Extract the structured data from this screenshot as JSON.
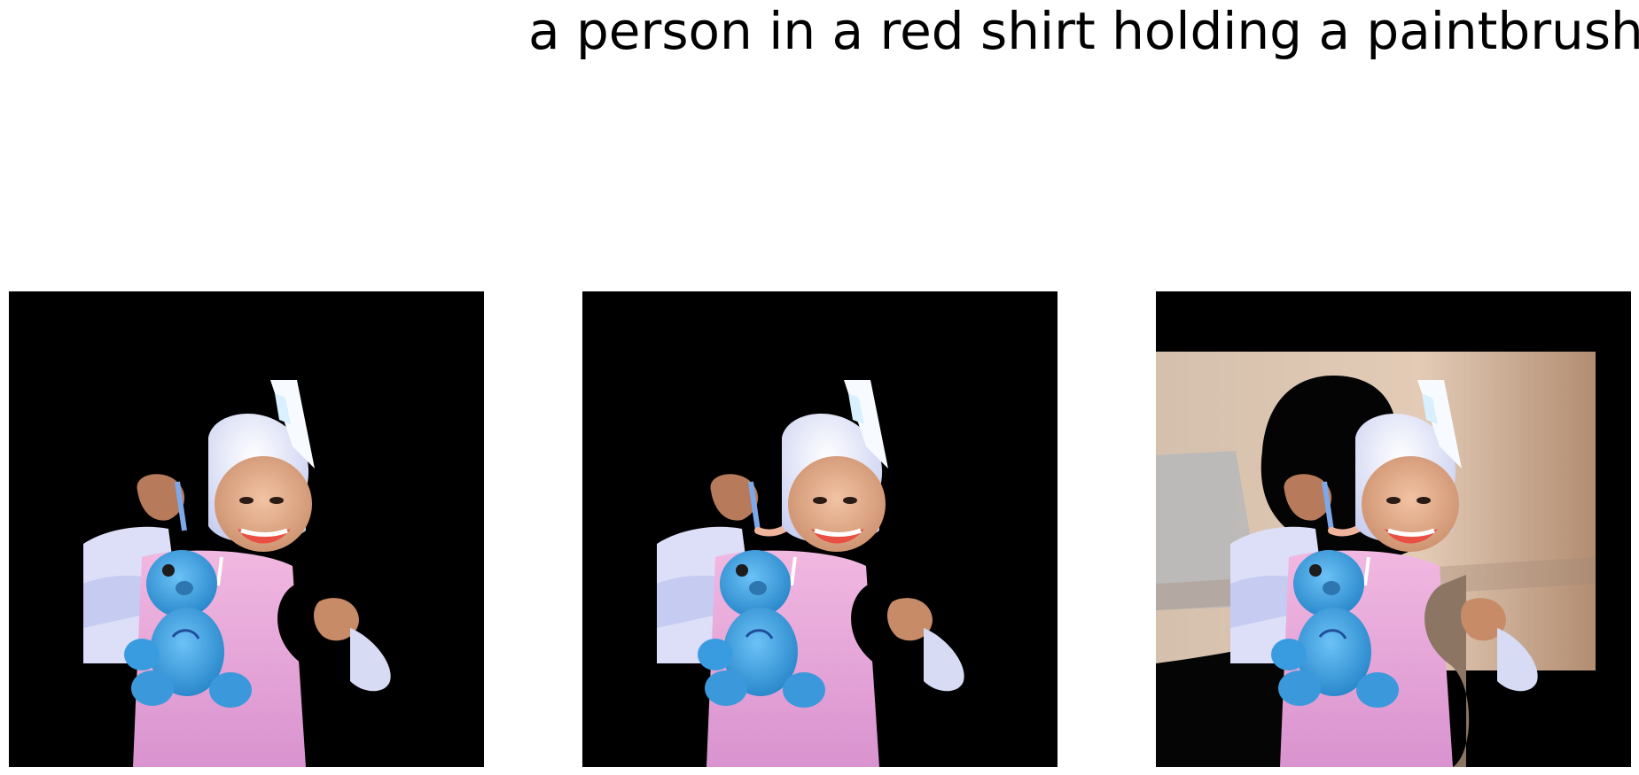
{
  "figure": {
    "caption": "a person in a red shirt holding a paintbrush.",
    "panels": [
      {
        "background": "black"
      },
      {
        "background": "black"
      },
      {
        "background": "partial room background"
      }
    ]
  },
  "colors": {
    "mask": "#000000",
    "hat": "#eef0fb",
    "shirt": "#e7a6d8",
    "sleeve": "#d9dcf5",
    "teddy": "#3b9fe0",
    "skin": "#d89a78",
    "wall": "#d8c0aa",
    "wall_shadow": "#a99988"
  }
}
